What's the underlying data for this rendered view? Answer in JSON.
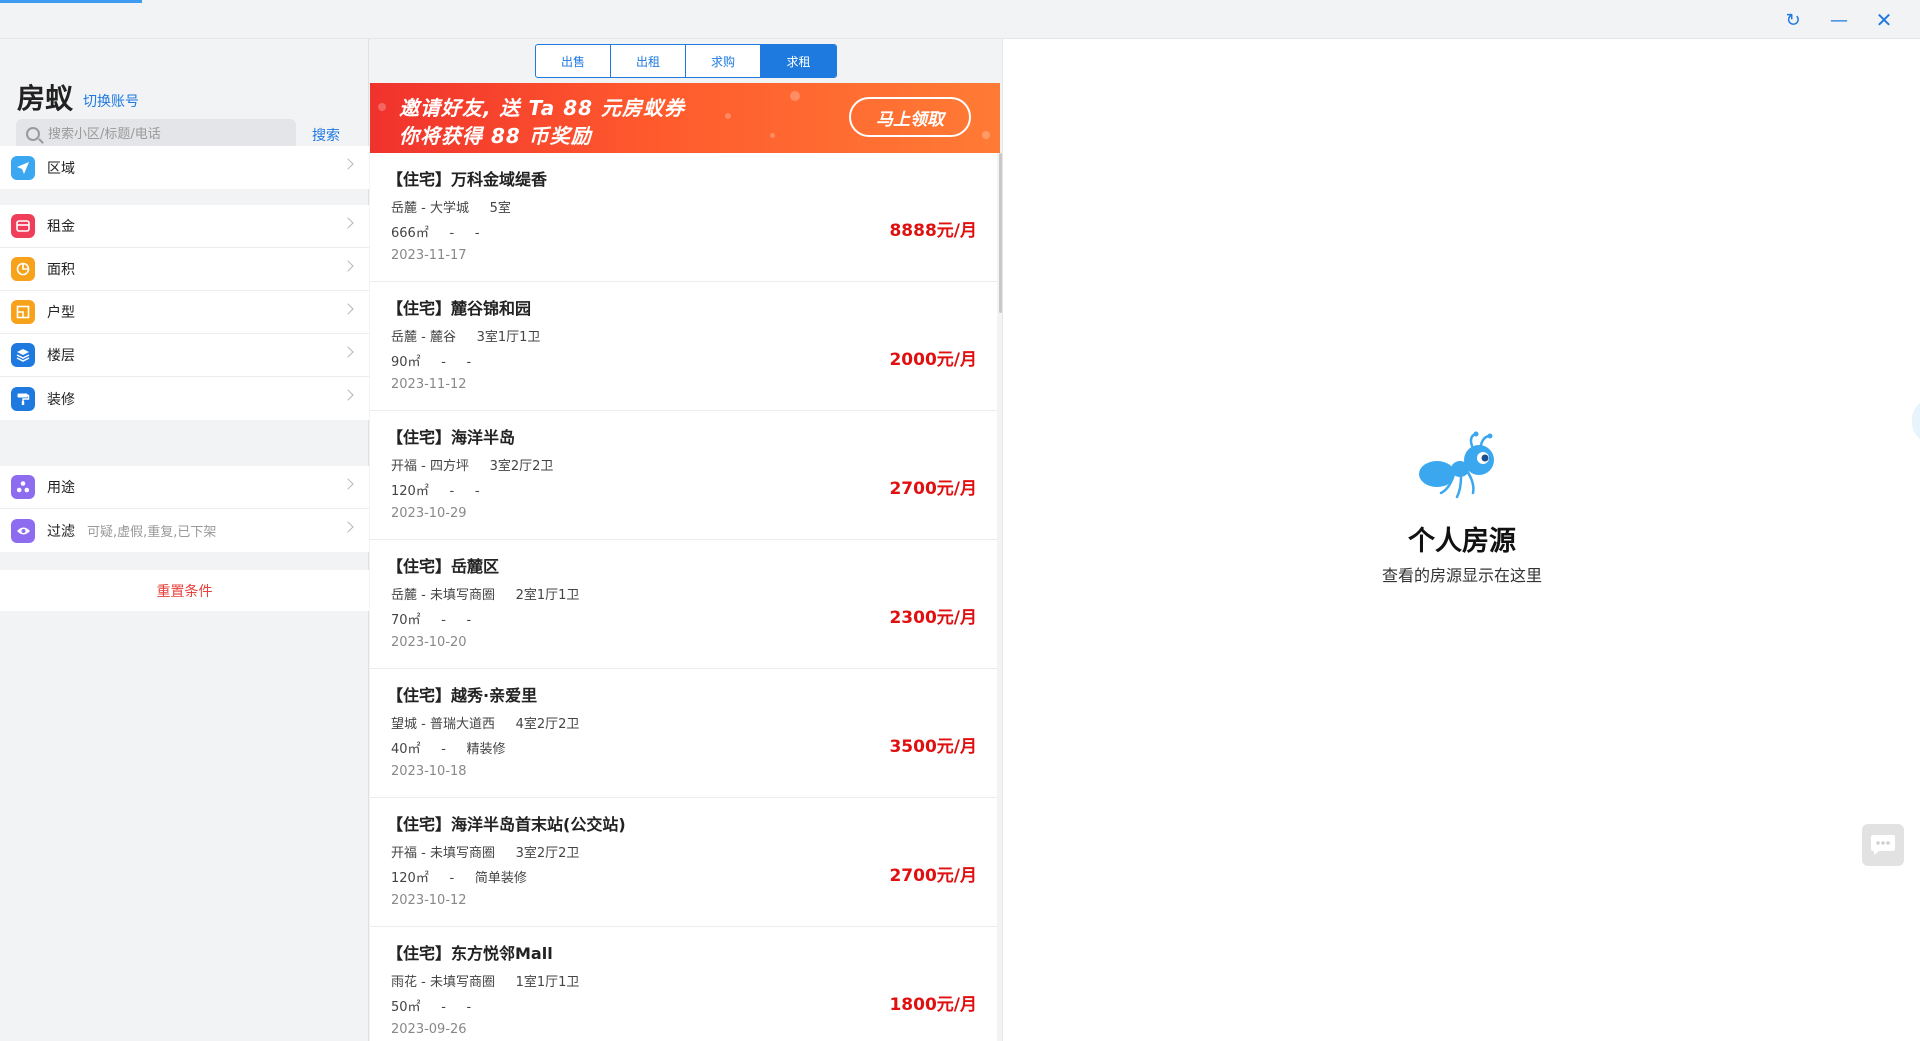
{
  "window": {
    "refresh_icon": "↻",
    "minimize_icon": "—",
    "close_icon": "✕"
  },
  "sidebar": {
    "brand": "房蚁",
    "switch_account": "切换账号",
    "search": {
      "placeholder": "搜索小区/标题/电话",
      "button": "搜索"
    },
    "filters_group1": [
      {
        "label": "区域",
        "icon": "location-arrow-icon",
        "color": "#3ba7f0"
      }
    ],
    "filters_group2": [
      {
        "label": "租金",
        "icon": "wallet-icon",
        "color": "#f03d5a"
      },
      {
        "label": "面积",
        "icon": "pie-icon",
        "color": "#f7a21b"
      },
      {
        "label": "户型",
        "icon": "floorplan-icon",
        "color": "#f7a21b"
      },
      {
        "label": "楼层",
        "icon": "layers-icon",
        "color": "#1f7ae0"
      },
      {
        "label": "装修",
        "icon": "paint-roller-icon",
        "color": "#1f7ae0"
      }
    ],
    "filters_group3": [
      {
        "label": "用途",
        "icon": "usage-icon",
        "color": "#8e6cf0",
        "hint": ""
      },
      {
        "label": "过滤",
        "icon": "eye-icon",
        "color": "#8e6cf0",
        "hint": "可疑,虚假,重复,已下架"
      }
    ],
    "reset": "重置条件"
  },
  "tabs": [
    {
      "label": "出售",
      "active": false
    },
    {
      "label": "出租",
      "active": false
    },
    {
      "label": "求购",
      "active": false
    },
    {
      "label": "求租",
      "active": true
    }
  ],
  "banner": {
    "line1": "邀请好友, 送 Ta 88 元房蚁券",
    "line2": "你将获得 88 币奖励",
    "cta": "马上领取"
  },
  "listings": [
    {
      "title": "【住宅】万科金域缇香",
      "location": "岳麓 - 大学城     5室",
      "size": "666㎡     -     -",
      "date": "2023-11-17",
      "price": "8888元/月"
    },
    {
      "title": "【住宅】麓谷锦和园",
      "location": "岳麓 - 麓谷     3室1厅1卫",
      "size": "90㎡     -     -",
      "date": "2023-11-12",
      "price": "2000元/月"
    },
    {
      "title": "【住宅】海洋半岛",
      "location": "开福 - 四方坪     3室2厅2卫",
      "size": "120㎡     -     -",
      "date": "2023-10-29",
      "price": "2700元/月"
    },
    {
      "title": "【住宅】岳麓区",
      "location": "岳麓 - 未填写商圈     2室1厅1卫",
      "size": "70㎡     -     -",
      "date": "2023-10-20",
      "price": "2300元/月"
    },
    {
      "title": "【住宅】越秀·亲爱里",
      "location": "望城 - 普瑞大道西     4室2厅2卫",
      "size": "40㎡     -     精装修",
      "date": "2023-10-18",
      "price": "3500元/月"
    },
    {
      "title": "【住宅】海洋半岛首末站(公交站)",
      "location": "开福 - 未填写商圈     3室2厅2卫",
      "size": "120㎡     -     简单装修",
      "date": "2023-10-12",
      "price": "2700元/月"
    },
    {
      "title": "【住宅】东方悦邻Mall",
      "location": "雨花 - 未填写商圈     1室1厅1卫",
      "size": "50㎡     -     -",
      "date": "2023-09-26",
      "price": "1800元/月"
    }
  ],
  "right_panel": {
    "title": "个人房源",
    "subtitle": "查看的房源显示在这里",
    "logo": "ant-logo",
    "chat_icon": "chat-bubble-icon"
  },
  "colors": {
    "accent": "#1f7ae0",
    "price": "#e01010",
    "reset": "#e8413b",
    "banner": "#ff5a2d"
  }
}
